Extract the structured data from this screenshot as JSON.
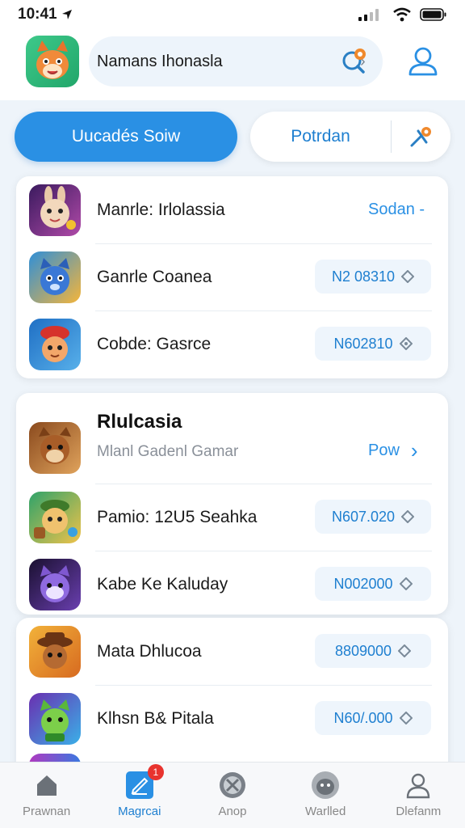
{
  "status_bar": {
    "time": "10:41"
  },
  "header": {
    "search_text": "Namans Ihonasla",
    "search_chevron": "›",
    "search_icon": "search-icon",
    "profile_icon": "user-icon"
  },
  "segments": {
    "primary_label": "Uucadés Soiw",
    "secondary_label": "Potrdan"
  },
  "card1": {
    "rows": [
      {
        "label": "Manrle: Irlolassia",
        "action": "Sodan -"
      },
      {
        "label": "Ganrle Coanea",
        "price": "N2 08310"
      },
      {
        "label": "Cobde: Gasrce",
        "price": "N602810"
      }
    ]
  },
  "card2": {
    "title": "Rlulcasia",
    "subtitle": "Mlanl Gadenl Gamar",
    "link": "Pow",
    "link_chevron": "›",
    "rows": [
      {
        "label": "Pamio: 12U5 Seahka",
        "price": "N607.020"
      },
      {
        "label": "Kabe Ke Kaluday",
        "price": "N002000"
      }
    ]
  },
  "card3": {
    "rows": [
      {
        "label": "Mata Dhlucoa",
        "price": "8809000"
      },
      {
        "label": "Klhsn B& Pitala",
        "price": "N60/.000"
      }
    ]
  },
  "tabs": [
    {
      "label": "Prawnan",
      "icon": "home-icon"
    },
    {
      "label": "Magrcai",
      "icon": "edit-icon",
      "badge": "1"
    },
    {
      "label": "Anop",
      "icon": "tools-icon"
    },
    {
      "label": "Warlled",
      "icon": "pet-icon"
    },
    {
      "label": "Dlefanm",
      "icon": "person-icon"
    }
  ],
  "colors": {
    "accent": "#2a90e4",
    "badge": "#e8332e"
  }
}
